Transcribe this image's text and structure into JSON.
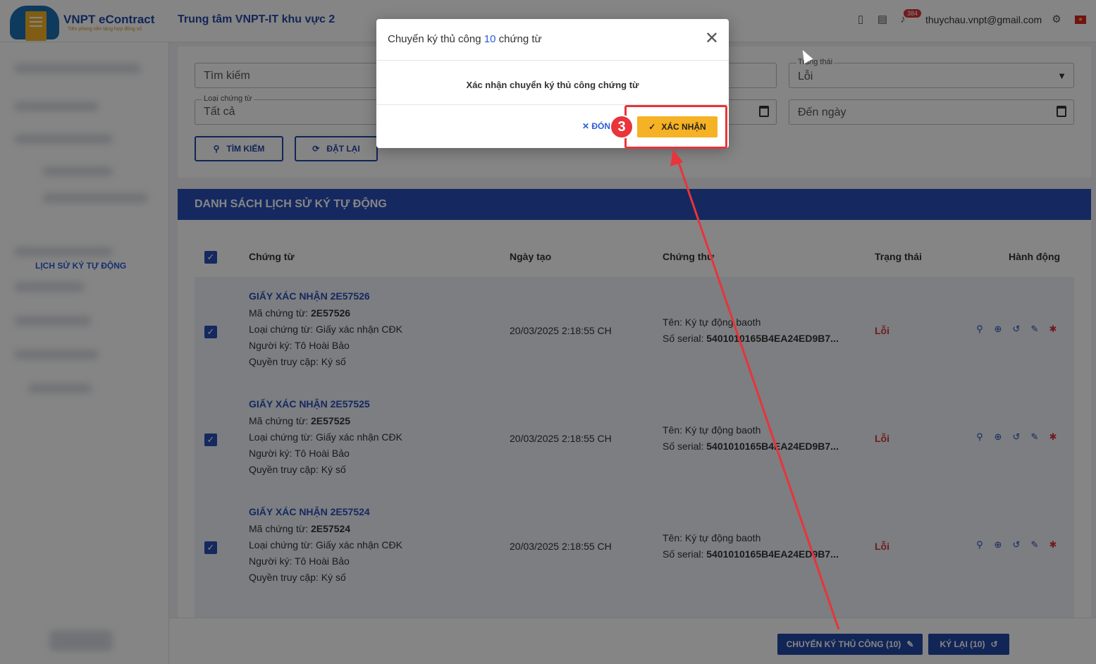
{
  "header": {
    "logo_title": "VNPT eContract",
    "logo_subtitle": "Tiên phong nền tảng hợp đồng số",
    "org_title": "Trung tâm VNPT-IT khu vực 2",
    "notification_count": "384",
    "user_email": "thuychau.vnpt@gmail.com"
  },
  "sidebar": {
    "active_item": "LỊCH SỬ KÝ TỰ ĐỘNG"
  },
  "search": {
    "keyword_placeholder": "Tìm kiếm",
    "status_label": "Trạng thái",
    "status_value": "Lỗi",
    "doc_type_label": "Loại chứng từ",
    "doc_type_value": "Tất cả",
    "to_date_placeholder": "Đến ngày",
    "search_button": "TÌM KIẾM",
    "reset_button": "ĐẶT LẠI"
  },
  "list": {
    "title": "DANH SÁCH LỊCH SỬ KÝ TỰ ĐỘNG",
    "columns": [
      "Chứng từ",
      "Ngày tạo",
      "Chứng thư",
      "Trạng thái",
      "Hành động"
    ],
    "rows": [
      {
        "title": "GIẤY XÁC NHẬN 2E57526",
        "code_label": "Mã chứng từ: ",
        "code": "2E57526",
        "type": "Loại chứng từ: Giấy xác nhận CĐK",
        "signer": "Người ký: Tô Hoài Bảo",
        "access": "Quyền truy cập: Ký số",
        "created": "20/03/2025 2:18:55 CH",
        "cert_name": "Tên: Ký tự động baoth",
        "serial_label": "Số serial: ",
        "serial": "5401010165B4EA24ED9B7...",
        "status": "Lỗi"
      },
      {
        "title": "GIẤY XÁC NHẬN 2E57525",
        "code_label": "Mã chứng từ: ",
        "code": "2E57525",
        "type": "Loại chứng từ: Giấy xác nhận CĐK",
        "signer": "Người ký: Tô Hoài Bảo",
        "access": "Quyền truy cập: Ký số",
        "created": "20/03/2025 2:18:55 CH",
        "cert_name": "Tên: Ký tự động baoth",
        "serial_label": "Số serial: ",
        "serial": "5401010165B4EA24ED9B7...",
        "status": "Lỗi"
      },
      {
        "title": "GIẤY XÁC NHẬN 2E57524",
        "code_label": "Mã chứng từ: ",
        "code": "2E57524",
        "type": "Loại chứng từ: Giấy xác nhận CĐK",
        "signer": "Người ký: Tô Hoài Bảo",
        "access": "Quyền truy cập: Ký số",
        "created": "20/03/2025 2:18:55 CH",
        "cert_name": "Tên: Ký tự động baoth",
        "serial_label": "Số serial: ",
        "serial": "5401010165B4EA24ED9B7...",
        "status": "Lỗi"
      }
    ]
  },
  "bottom_actions": {
    "manual_sign": "CHUYỂN KÝ THỦ CÔNG (10)",
    "resign": "KÝ LẠI (10)"
  },
  "modal": {
    "title_prefix": "Chuyển ký thủ công ",
    "title_count": "10",
    "title_suffix": " chứng từ",
    "message": "Xác nhận chuyển ký thủ công chứng từ",
    "close_button": "ĐÓNG",
    "confirm_button": "XÁC NHẬN"
  },
  "annotation": {
    "step": "3"
  },
  "colors": {
    "primary": "#2a4fb8",
    "accent": "#f5b224",
    "error": "#d8343a",
    "annotation": "#e8343a"
  }
}
